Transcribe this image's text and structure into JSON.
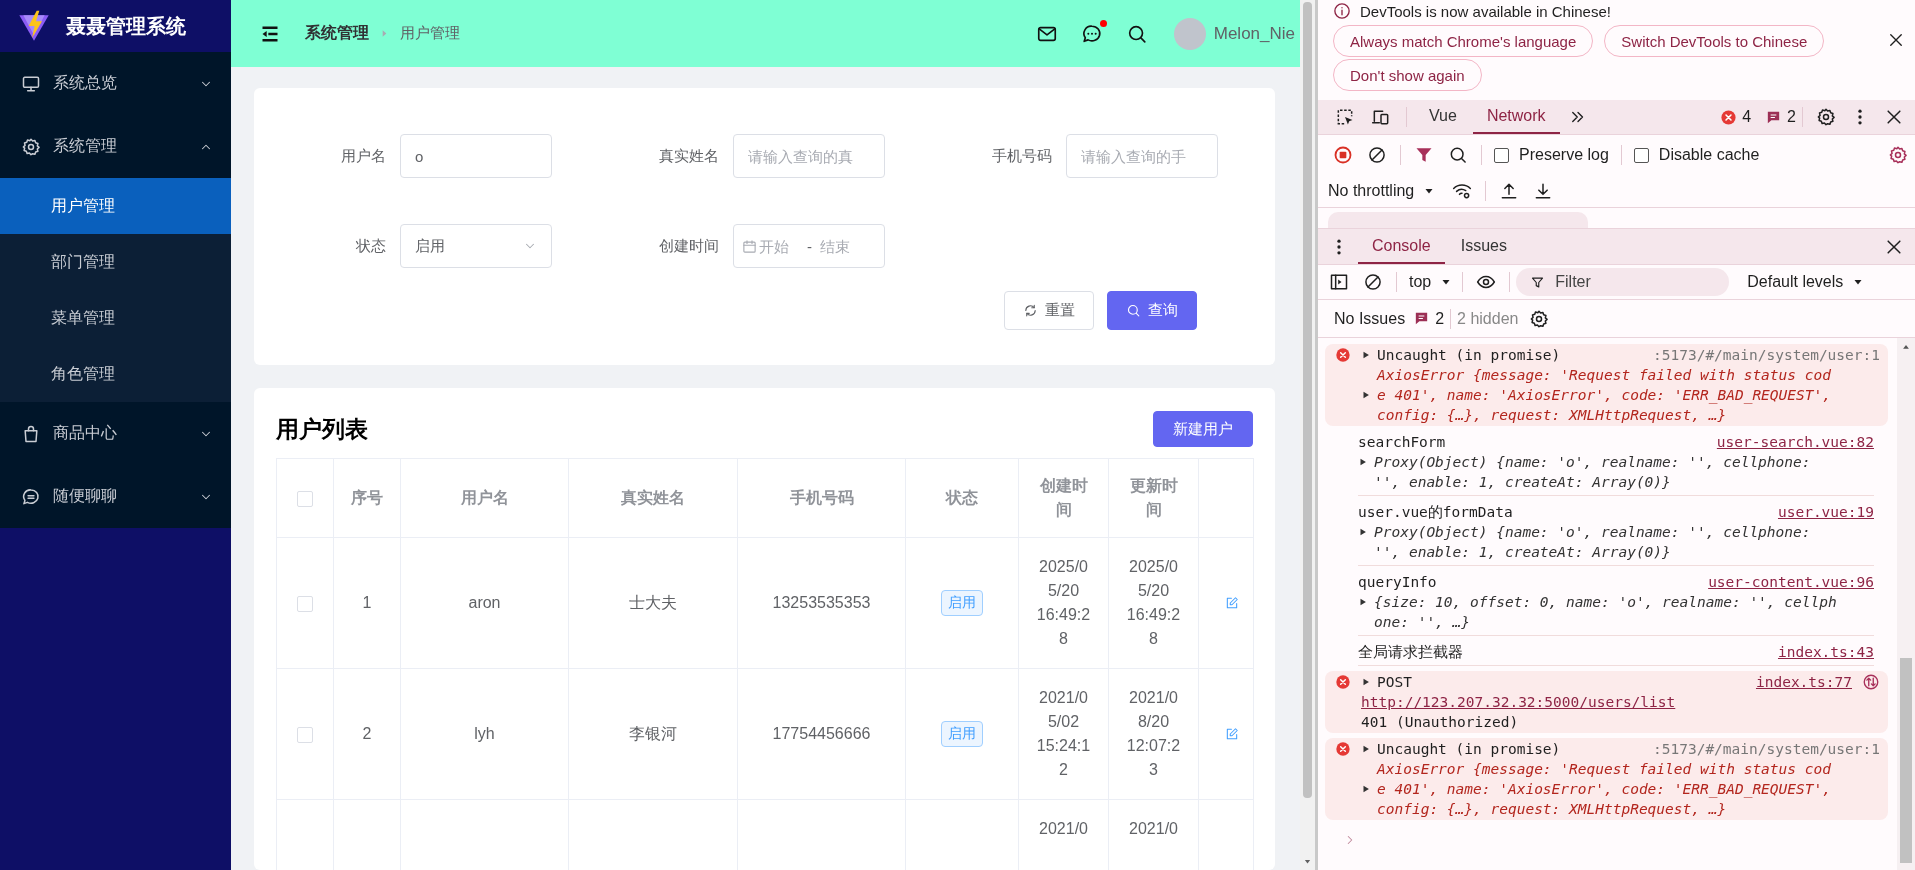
{
  "sidebar": {
    "title": "聂聂管理系统",
    "menu": [
      {
        "label": "系统总览",
        "expanded": false
      },
      {
        "label": "系统管理",
        "expanded": true,
        "children": [
          {
            "label": "用户管理",
            "selected": true
          },
          {
            "label": "部门管理",
            "selected": false
          },
          {
            "label": "菜单管理",
            "selected": false
          },
          {
            "label": "角色管理",
            "selected": false
          }
        ]
      },
      {
        "label": "商品中心",
        "expanded": false
      },
      {
        "label": "随便聊聊",
        "expanded": false
      }
    ]
  },
  "header": {
    "breadcrumb": [
      {
        "label": "系统管理",
        "current": false
      },
      {
        "label": "用户管理",
        "current": true
      }
    ],
    "chat_unread": true,
    "user_name": "Melon_Nie"
  },
  "search_form": {
    "fields": [
      {
        "kind": "text",
        "label": "用户名",
        "value": "o"
      },
      {
        "kind": "text",
        "label": "真实姓名",
        "placeholder": "请输入查询的真"
      },
      {
        "kind": "text",
        "label": "手机号码",
        "placeholder": "请输入查询的手"
      },
      {
        "kind": "select",
        "label": "状态",
        "value": "启用"
      },
      {
        "kind": "daterange",
        "label": "创建时间",
        "start_placeholder": "开始",
        "separator": "-",
        "end_placeholder": "结束"
      }
    ],
    "buttons": [
      {
        "kind": "secondary",
        "label": "重置"
      },
      {
        "kind": "primary",
        "label": "查询"
      }
    ]
  },
  "table": {
    "title": "用户列表",
    "new_button": "新建用户",
    "select_all_checked": false,
    "columns": [
      "序号",
      "用户名",
      "真实姓名",
      "手机号码",
      "状态",
      "创建时间",
      "更新时间"
    ],
    "rows": [
      {
        "checked": false,
        "index": "1",
        "username": "aron",
        "realname": "士大夫",
        "phone": "13253535353",
        "status": "启用",
        "enabled": true,
        "created": "2025/05/20 16:49:28",
        "updated": "2025/05/20 16:49:28"
      },
      {
        "checked": false,
        "index": "2",
        "username": "lyh",
        "realname": "李银河",
        "phone": "17754456666",
        "status": "启用",
        "enabled": true,
        "created": "2021/05/02 15:24:12",
        "updated": "2021/08/20 12:07:23"
      },
      {
        "created": "2021/0",
        "updated": "2021/0"
      }
    ]
  },
  "devtools": {
    "banner": {
      "message": "DevTools is now available in Chinese!",
      "buttons": [
        "Always match Chrome's language",
        "Switch DevTools to Chinese",
        "Don't show again"
      ]
    },
    "tabs": [
      {
        "label": "Vue",
        "selected": false
      },
      {
        "label": "Network",
        "selected": true
      }
    ],
    "error_count": "4",
    "message_count": "2",
    "network": {
      "checkboxes": [
        {
          "label": "Preserve log",
          "checked": false
        },
        {
          "label": "Disable cache",
          "checked": false
        }
      ],
      "throttling": "No throttling"
    }
  },
  "console": {
    "tabs": [
      {
        "label": "Console",
        "selected": true
      },
      {
        "label": "Issues",
        "selected": false
      }
    ],
    "context": "top",
    "filter_placeholder": "Filter",
    "levels": "Default levels",
    "issues_label": "No Issues",
    "issues_count": "2",
    "hidden": "2 hidden",
    "messages": [
      {
        "kind": "error",
        "source": ":5173/#/main/system/user:1",
        "source_link": false,
        "lines": [
          {
            "text": "Uncaught (in promise)",
            "arrow": true,
            "kind": "plain"
          },
          {
            "text": "AxiosError {message: 'Request failed with status cod",
            "arrow": false,
            "kind": "object"
          },
          {
            "text": "e 401', name: 'AxiosError', code: 'ERR_BAD_REQUEST',",
            "arrow": true,
            "kind": "object"
          },
          {
            "text": "config: {…}, request: XMLHttpRequest, …}",
            "arrow": false,
            "kind": "object"
          }
        ]
      },
      {
        "kind": "log",
        "source": "user-search.vue:82",
        "source_link": true,
        "lines": [
          {
            "text": "searchForm",
            "arrow": false,
            "kind": "plain"
          },
          {
            "text": "Proxy(Object) {name: 'o', realname: '', cellphone:",
            "arrow": true,
            "kind": "object"
          },
          {
            "text": "'', enable: 1, createAt: Array(0)}",
            "arrow": false,
            "kind": "object"
          }
        ]
      },
      {
        "kind": "log",
        "source": "user.vue:19",
        "source_link": true,
        "lines": [
          {
            "text": "user.vue的formData",
            "arrow": false,
            "kind": "plain"
          },
          {
            "text": "Proxy(Object) {name: 'o', realname: '', cellphone:",
            "arrow": true,
            "kind": "object"
          },
          {
            "text": "'', enable: 1, createAt: Array(0)}",
            "arrow": false,
            "kind": "object"
          }
        ]
      },
      {
        "kind": "log",
        "source": "user-content.vue:96",
        "source_link": true,
        "lines": [
          {
            "text": "queryInfo",
            "arrow": false,
            "kind": "plain"
          },
          {
            "text": "{size: 10, offset: 0, name: 'o', realname: '', cellph",
            "arrow": true,
            "kind": "object"
          },
          {
            "text": "one: '', …}",
            "arrow": false,
            "kind": "object"
          }
        ]
      },
      {
        "kind": "log",
        "source": "index.ts:43",
        "source_link": true,
        "lines": [
          {
            "text": "全局请求拦截器",
            "arrow": false,
            "kind": "plain"
          }
        ]
      },
      {
        "kind": "error",
        "source": "index.ts:77",
        "source_link": true,
        "network_icon": true,
        "lines": [
          {
            "text": "POST",
            "arrow": true,
            "kind": "plain"
          },
          {
            "text": "http://123.207.32.32:5000/users/list",
            "arrow": false,
            "kind": "link"
          },
          {
            "text": "401 (Unauthorized)",
            "arrow": false,
            "kind": "plain"
          }
        ]
      },
      {
        "kind": "error",
        "source": ":5173/#/main/system/user:1",
        "source_link": false,
        "lines": [
          {
            "text": "Uncaught (in promise)",
            "arrow": true,
            "kind": "plain"
          },
          {
            "text": "AxiosError {message: 'Request failed with status cod",
            "arrow": false,
            "kind": "object"
          },
          {
            "text": "e 401', name: 'AxiosError', code: 'ERR_BAD_REQUEST',",
            "arrow": true,
            "kind": "object"
          },
          {
            "text": "config: {…}, request: XMLHttpRequest, …}",
            "arrow": false,
            "kind": "object"
          }
        ]
      }
    ]
  }
}
